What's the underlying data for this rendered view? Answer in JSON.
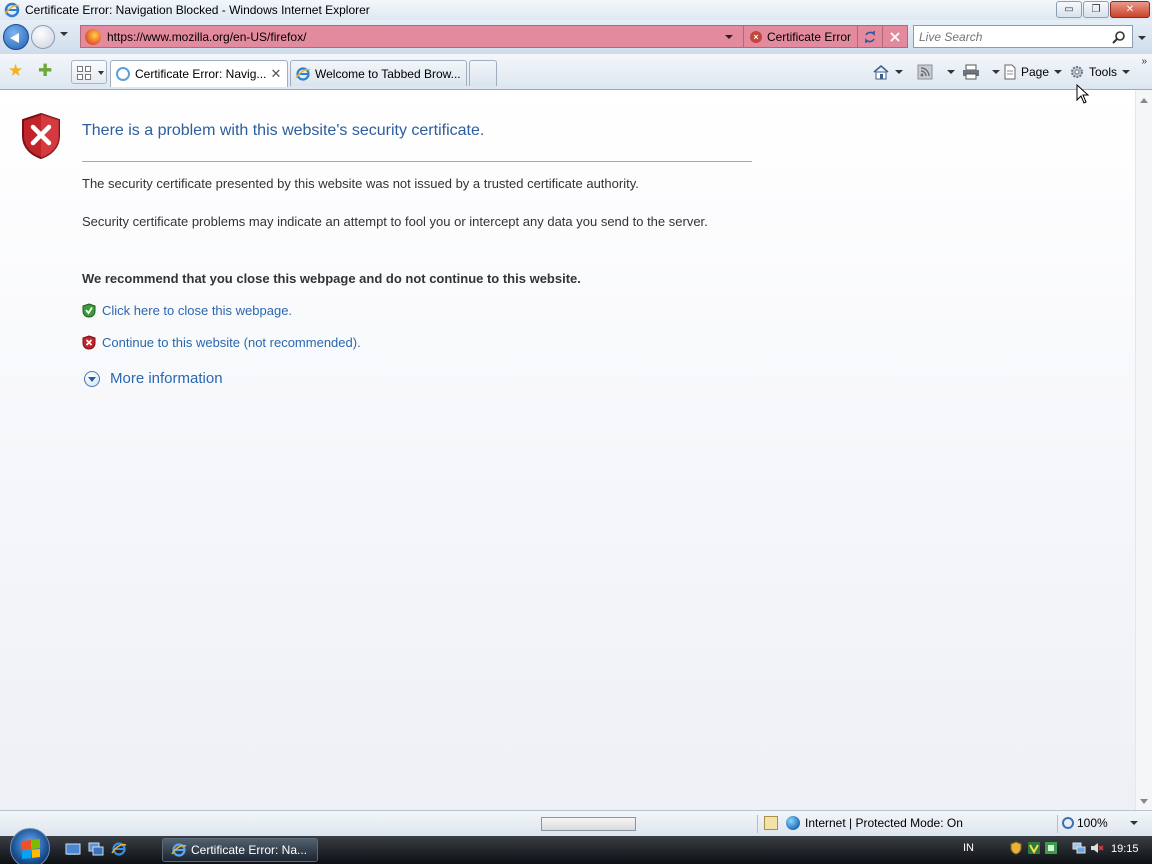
{
  "window": {
    "title": "Certificate Error: Navigation Blocked - Windows Internet Explorer",
    "buttons": {
      "minimize": "▭",
      "maximize": "❐",
      "close": "✕"
    }
  },
  "addressbar": {
    "url": "https://www.mozilla.org/en-US/firefox/",
    "certificate_status": "Certificate Error",
    "search_placeholder": "Live Search"
  },
  "tabs": [
    {
      "label": "Certificate Error: Navig...",
      "active": true,
      "close": "✕"
    },
    {
      "label": "Welcome to Tabbed Brow...",
      "active": false
    }
  ],
  "commandbar": {
    "page_label": "Page",
    "tools_label": "Tools",
    "overflow": "»"
  },
  "content": {
    "heading": "There is a problem with this website's security certificate.",
    "paragraph1": "The security certificate presented by this website was not issued by a trusted certificate authority.",
    "paragraph2": "Security certificate problems may indicate an attempt to fool you or intercept any data you send to the server.",
    "recommendation": "We recommend that you close this webpage and do not continue to this website.",
    "link_close": "Click here to close this webpage.",
    "link_continue": "Continue to this website (not recommended).",
    "more_info": "More information"
  },
  "statusbar": {
    "zone": "Internet | Protected Mode: On",
    "zoom": "100%"
  },
  "taskbar": {
    "task_label": "Certificate Error: Na...",
    "language": "IN",
    "clock": "19:15"
  },
  "colors": {
    "address_error_bg": "#e48a9f",
    "link": "#2a67b1",
    "heading": "#2c5d9c"
  }
}
